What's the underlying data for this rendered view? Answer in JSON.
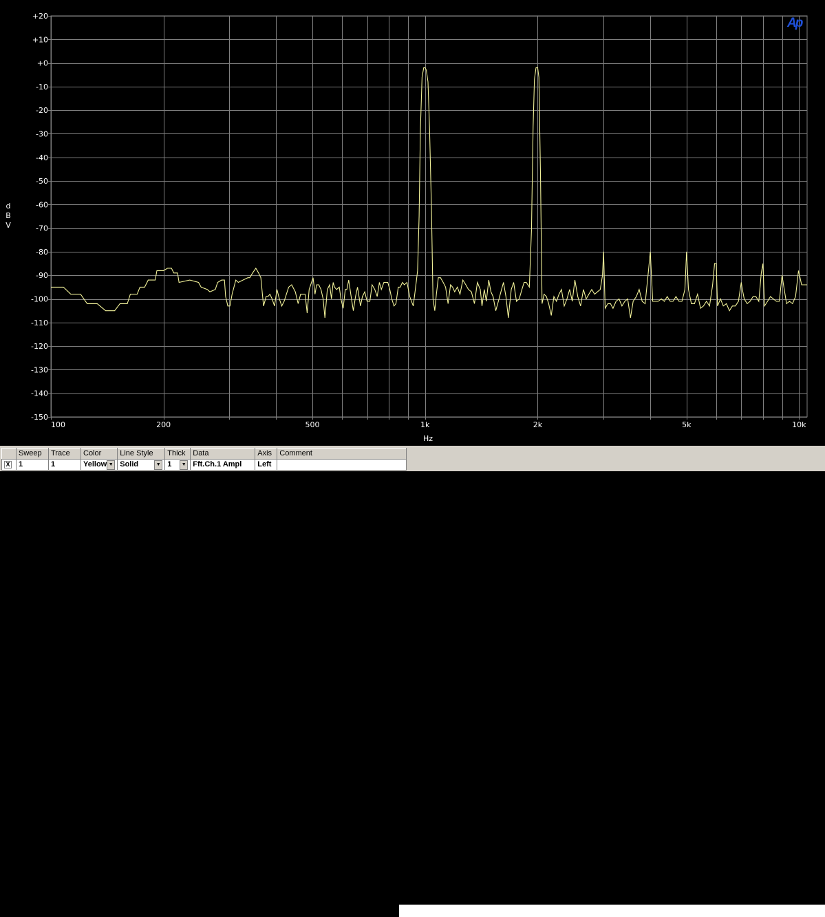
{
  "chart_data": {
    "type": "line",
    "xlabel": "Hz",
    "ylabel": "dBV",
    "ylabel_letters": [
      "d",
      "B",
      "V"
    ],
    "x_scale": "log",
    "xlim": [
      100,
      10500
    ],
    "ylim": [
      -150,
      20
    ],
    "y_ticks": [
      20,
      10,
      0,
      -10,
      -20,
      -30,
      -40,
      -50,
      -60,
      -70,
      -80,
      -90,
      -100,
      -110,
      -120,
      -130,
      -140,
      -150
    ],
    "y_tick_labels": [
      "+20",
      "+10",
      "+0",
      "-10",
      "-20",
      "-30",
      "-40",
      "-50",
      "-60",
      "-70",
      "-80",
      "-90",
      "-100",
      "-110",
      "-120",
      "-130",
      "-140",
      "-150"
    ],
    "x_ticks": [
      100,
      200,
      500,
      1000,
      2000,
      5000,
      10000
    ],
    "x_tick_labels": [
      "100",
      "200",
      "500",
      "1k",
      "2k",
      "5k",
      "10k"
    ],
    "x_minor_gridlines": [
      300,
      400,
      600,
      700,
      800,
      900,
      3000,
      4000,
      6000,
      7000,
      8000,
      9000
    ],
    "grid": true,
    "background": "#000000",
    "grid_color": "#808080",
    "series": [
      {
        "color": "#f2f29a",
        "points": [
          [
            100,
            -95
          ],
          [
            108,
            -95
          ],
          [
            113,
            -98
          ],
          [
            120,
            -98
          ],
          [
            125,
            -102
          ],
          [
            133,
            -102
          ],
          [
            140,
            -105
          ],
          [
            148,
            -105
          ],
          [
            153,
            -102
          ],
          [
            160,
            -102
          ],
          [
            163,
            -98
          ],
          [
            170,
            -98
          ],
          [
            173,
            -95
          ],
          [
            178,
            -95
          ],
          [
            182,
            -92
          ],
          [
            190,
            -92
          ],
          [
            192,
            -88
          ],
          [
            200,
            -88
          ],
          [
            205,
            -87
          ],
          [
            210,
            -87
          ],
          [
            213,
            -89
          ],
          [
            218,
            -89
          ],
          [
            220,
            -93
          ],
          [
            235,
            -92
          ],
          [
            248,
            -93
          ],
          [
            252,
            -95
          ],
          [
            262,
            -96
          ],
          [
            266,
            -97
          ],
          [
            275,
            -96
          ],
          [
            279,
            -93
          ],
          [
            286,
            -92
          ],
          [
            291,
            -92
          ],
          [
            293,
            -99
          ],
          [
            297,
            -103
          ],
          [
            301,
            -103
          ],
          [
            305,
            -98
          ],
          [
            312,
            -92
          ],
          [
            317,
            -93
          ],
          [
            326,
            -92
          ],
          [
            336,
            -91
          ],
          [
            340,
            -91
          ],
          [
            346,
            -89
          ],
          [
            353,
            -87
          ],
          [
            359,
            -89
          ],
          [
            364,
            -91
          ],
          [
            370,
            -103
          ],
          [
            376,
            -99
          ],
          [
            380,
            -99
          ],
          [
            385,
            -98
          ],
          [
            390,
            -100
          ],
          [
            396,
            -103
          ],
          [
            402,
            -96
          ],
          [
            408,
            -100
          ],
          [
            414,
            -103
          ],
          [
            420,
            -101
          ],
          [
            432,
            -95
          ],
          [
            440,
            -94
          ],
          [
            450,
            -97
          ],
          [
            458,
            -102
          ],
          [
            465,
            -98
          ],
          [
            478,
            -98
          ],
          [
            484,
            -106
          ],
          [
            490,
            -96
          ],
          [
            502,
            -91
          ],
          [
            508,
            -98
          ],
          [
            513,
            -94
          ],
          [
            520,
            -94
          ],
          [
            527,
            -96
          ],
          [
            534,
            -100
          ],
          [
            540,
            -108
          ],
          [
            548,
            -96
          ],
          [
            556,
            -94
          ],
          [
            562,
            -100
          ],
          [
            568,
            -93
          ],
          [
            573,
            -95
          ],
          [
            580,
            -96
          ],
          [
            590,
            -95
          ],
          [
            596,
            -100
          ],
          [
            604,
            -104
          ],
          [
            612,
            -96
          ],
          [
            618,
            -96
          ],
          [
            625,
            -92
          ],
          [
            633,
            -98
          ],
          [
            643,
            -105
          ],
          [
            652,
            -99
          ],
          [
            660,
            -95
          ],
          [
            672,
            -103
          ],
          [
            680,
            -99
          ],
          [
            690,
            -97
          ],
          [
            700,
            -101
          ],
          [
            712,
            -101
          ],
          [
            722,
            -94
          ],
          [
            734,
            -96
          ],
          [
            745,
            -99
          ],
          [
            755,
            -93
          ],
          [
            764,
            -96
          ],
          [
            776,
            -93
          ],
          [
            795,
            -93
          ],
          [
            805,
            -96
          ],
          [
            815,
            -100
          ],
          [
            826,
            -103
          ],
          [
            836,
            -102
          ],
          [
            848,
            -95
          ],
          [
            858,
            -95
          ],
          [
            870,
            -93
          ],
          [
            880,
            -94
          ],
          [
            895,
            -93
          ],
          [
            910,
            -99
          ],
          [
            920,
            -101
          ],
          [
            930,
            -103
          ],
          [
            942,
            -96
          ],
          [
            955,
            -88
          ],
          [
            964,
            -65
          ],
          [
            972,
            -28
          ],
          [
            982,
            -6
          ],
          [
            992,
            -2
          ],
          [
            1000,
            -2
          ],
          [
            1008,
            -3
          ],
          [
            1018,
            -8
          ],
          [
            1028,
            -28
          ],
          [
            1040,
            -61
          ],
          [
            1050,
            -100
          ],
          [
            1062,
            -105
          ],
          [
            1072,
            -98
          ],
          [
            1085,
            -91
          ],
          [
            1100,
            -91
          ],
          [
            1118,
            -93
          ],
          [
            1135,
            -95
          ],
          [
            1152,
            -102
          ],
          [
            1170,
            -94
          ],
          [
            1185,
            -95
          ],
          [
            1200,
            -97
          ],
          [
            1220,
            -95
          ],
          [
            1240,
            -98
          ],
          [
            1262,
            -92
          ],
          [
            1285,
            -94
          ],
          [
            1306,
            -96
          ],
          [
            1330,
            -97
          ],
          [
            1355,
            -102
          ],
          [
            1380,
            -93
          ],
          [
            1405,
            -96
          ],
          [
            1420,
            -103
          ],
          [
            1440,
            -96
          ],
          [
            1458,
            -101
          ],
          [
            1480,
            -92
          ],
          [
            1500,
            -97
          ],
          [
            1520,
            -99
          ],
          [
            1545,
            -105
          ],
          [
            1570,
            -101
          ],
          [
            1595,
            -97
          ],
          [
            1620,
            -93
          ],
          [
            1645,
            -99
          ],
          [
            1670,
            -108
          ],
          [
            1700,
            -96
          ],
          [
            1725,
            -93
          ],
          [
            1755,
            -101
          ],
          [
            1785,
            -100
          ],
          [
            1815,
            -96
          ],
          [
            1840,
            -93
          ],
          [
            1865,
            -93
          ],
          [
            1900,
            -95
          ],
          [
            1925,
            -71
          ],
          [
            1945,
            -27
          ],
          [
            1960,
            -7
          ],
          [
            1980,
            -2
          ],
          [
            2000,
            -2
          ],
          [
            2015,
            -6
          ],
          [
            2035,
            -47
          ],
          [
            2055,
            -102
          ],
          [
            2080,
            -98
          ],
          [
            2110,
            -99
          ],
          [
            2140,
            -102
          ],
          [
            2175,
            -107
          ],
          [
            2210,
            -99
          ],
          [
            2245,
            -101
          ],
          [
            2280,
            -98
          ],
          [
            2315,
            -96
          ],
          [
            2355,
            -103
          ],
          [
            2395,
            -100
          ],
          [
            2435,
            -96
          ],
          [
            2475,
            -101
          ],
          [
            2515,
            -92
          ],
          [
            2560,
            -99
          ],
          [
            2605,
            -103
          ],
          [
            2650,
            -96
          ],
          [
            2695,
            -100
          ],
          [
            2740,
            -98
          ],
          [
            2790,
            -96
          ],
          [
            2840,
            -98
          ],
          [
            2890,
            -97
          ],
          [
            2940,
            -96
          ],
          [
            2980,
            -90
          ],
          [
            3000,
            -80
          ],
          [
            3030,
            -104
          ],
          [
            3080,
            -102
          ],
          [
            3130,
            -102
          ],
          [
            3180,
            -104
          ],
          [
            3240,
            -101
          ],
          [
            3300,
            -100
          ],
          [
            3360,
            -103
          ],
          [
            3420,
            -101
          ],
          [
            3480,
            -100
          ],
          [
            3540,
            -108
          ],
          [
            3600,
            -101
          ],
          [
            3670,
            -99
          ],
          [
            3735,
            -96
          ],
          [
            3805,
            -101
          ],
          [
            3875,
            -102
          ],
          [
            3945,
            -90
          ],
          [
            4000,
            -80
          ],
          [
            4060,
            -101
          ],
          [
            4130,
            -101
          ],
          [
            4200,
            -101
          ],
          [
            4280,
            -100
          ],
          [
            4360,
            -101
          ],
          [
            4440,
            -99
          ],
          [
            4520,
            -101
          ],
          [
            4600,
            -101
          ],
          [
            4685,
            -99
          ],
          [
            4770,
            -101
          ],
          [
            4860,
            -101
          ],
          [
            4950,
            -96
          ],
          [
            5000,
            -80
          ],
          [
            5060,
            -96
          ],
          [
            5150,
            -102
          ],
          [
            5250,
            -102
          ],
          [
            5350,
            -98
          ],
          [
            5450,
            -104
          ],
          [
            5550,
            -103
          ],
          [
            5650,
            -101
          ],
          [
            5760,
            -103
          ],
          [
            5870,
            -94
          ],
          [
            5940,
            -85
          ],
          [
            6000,
            -85
          ],
          [
            6050,
            -103
          ],
          [
            6160,
            -100
          ],
          [
            6270,
            -103
          ],
          [
            6390,
            -102
          ],
          [
            6510,
            -105
          ],
          [
            6630,
            -103
          ],
          [
            6750,
            -103
          ],
          [
            6880,
            -101
          ],
          [
            7000,
            -93
          ],
          [
            7050,
            -96
          ],
          [
            7130,
            -100
          ],
          [
            7260,
            -102
          ],
          [
            7390,
            -101
          ],
          [
            7530,
            -99
          ],
          [
            7660,
            -99
          ],
          [
            7800,
            -101
          ],
          [
            7920,
            -89
          ],
          [
            8000,
            -85
          ],
          [
            8080,
            -103
          ],
          [
            8230,
            -101
          ],
          [
            8380,
            -99
          ],
          [
            8530,
            -100
          ],
          [
            8690,
            -101
          ],
          [
            8850,
            -101
          ],
          [
            9000,
            -90
          ],
          [
            9080,
            -94
          ],
          [
            9250,
            -102
          ],
          [
            9420,
            -101
          ],
          [
            9600,
            -102
          ],
          [
            9780,
            -99
          ],
          [
            9960,
            -88
          ],
          [
            10150,
            -94
          ],
          [
            10350,
            -94
          ],
          [
            10500,
            -94
          ]
        ]
      }
    ]
  },
  "logo_text": "Ap",
  "legend_table": {
    "headers": [
      "Sweep",
      "Trace",
      "Color",
      "Line Style",
      "Thick",
      "Data",
      "Axis",
      "Comment"
    ],
    "row": {
      "checkbox": "X",
      "sweep": "1",
      "trace": "1",
      "color": "Yellow",
      "line_style": "Solid",
      "thick": "1",
      "data": "Fft.Ch.1 Ampl",
      "axis": "Left",
      "comment": ""
    }
  }
}
